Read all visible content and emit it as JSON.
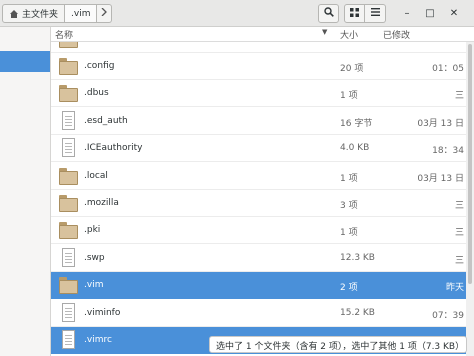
{
  "header": {
    "breadcrumbs": [
      {
        "label": "主文件夹",
        "icon": "home-icon"
      },
      {
        "label": ".vim"
      }
    ],
    "next_icon": "chevron-right-icon",
    "toolbar": {
      "search_icon": "search-icon",
      "view_grid_icon": "grid-view-icon",
      "menu_icon": "hamburger-menu-icon"
    },
    "window": {
      "minimize_label": "–",
      "maximize_label": "□",
      "close_label": "✕"
    }
  },
  "columns": {
    "name": "名称",
    "size": "大小",
    "modified": "已修改"
  },
  "files": [
    {
      "name": ".config",
      "type": "folder",
      "size": "20 项",
      "modified": "01：05"
    },
    {
      "name": ".dbus",
      "type": "folder",
      "size": "1 项",
      "modified": "三"
    },
    {
      "name": ".esd_auth",
      "type": "file",
      "size": "16 字节",
      "modified": "03月 13 日"
    },
    {
      "name": ".ICEauthority",
      "type": "file",
      "size": "4.0 KB",
      "modified": "18：34"
    },
    {
      "name": ".local",
      "type": "folder",
      "size": "1 项",
      "modified": "03月 13 日"
    },
    {
      "name": ".mozilla",
      "type": "folder",
      "size": "3 项",
      "modified": "三"
    },
    {
      "name": ".pki",
      "type": "folder",
      "size": "1 项",
      "modified": "三"
    },
    {
      "name": ".swp",
      "type": "file",
      "size": "12.3 KB",
      "modified": "三"
    },
    {
      "name": ".vim",
      "type": "folder",
      "size": "2 项",
      "modified": "昨天",
      "selected": true
    },
    {
      "name": ".viminfo",
      "type": "file",
      "size": "15.2 KB",
      "modified": "07：39"
    },
    {
      "name": ".vimrc",
      "type": "file",
      "size": "",
      "modified": "",
      "selected": true
    }
  ],
  "status": {
    "text": "选中了 1 个文件夹（含有 2 项），选中了其他 1 项（7.3 KB）"
  },
  "colors": {
    "selection": "#4a90d9",
    "header_bg": "#e8e8e7",
    "folder": "#d8c29d"
  }
}
